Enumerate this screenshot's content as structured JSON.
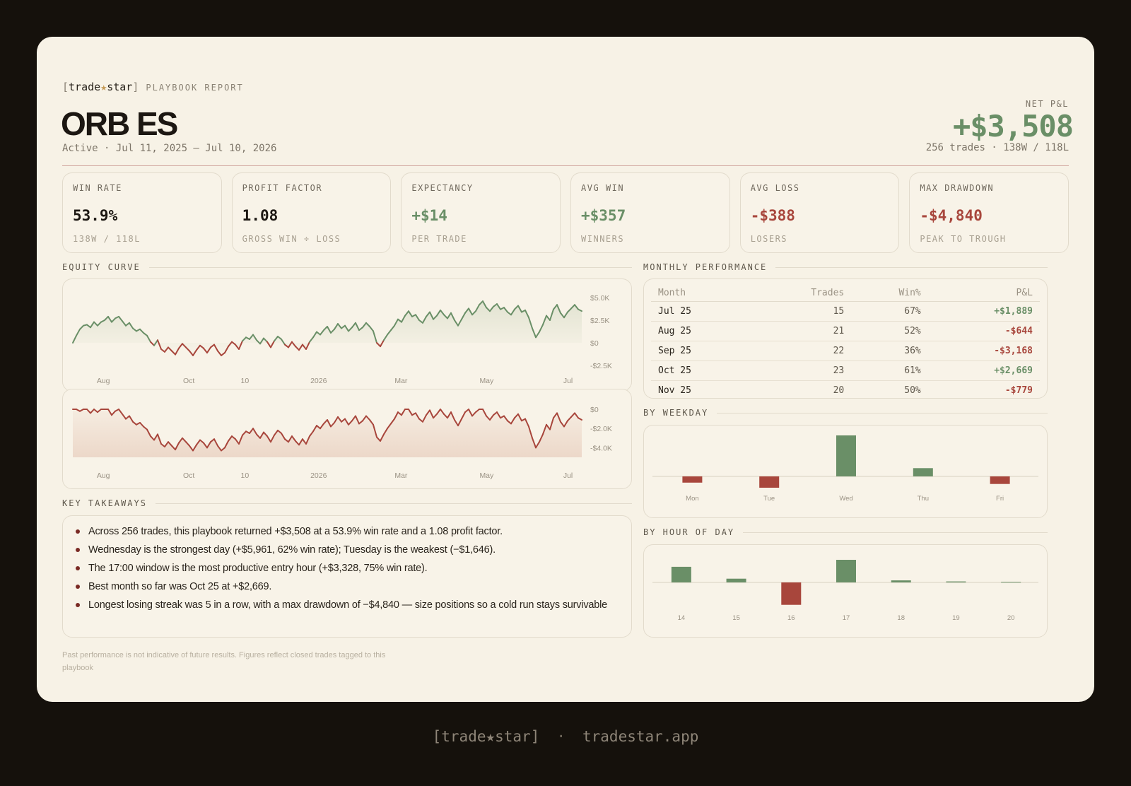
{
  "brand": {
    "open": "[",
    "name_a": "trade",
    "star": "★",
    "name_b": "star",
    "close": "]",
    "report_label": "PLAYBOOK REPORT"
  },
  "playbook": {
    "title": "ORB ES",
    "subtitle": "Active · Jul 11, 2025 – Jul 10, 2026"
  },
  "net": {
    "label": "NET P&L",
    "value": "+$3,508",
    "sub": "256 trades · 138W / 118L"
  },
  "stats": [
    {
      "label": "WIN RATE",
      "value": "53.9%",
      "sub": "138W / 118L",
      "tone": "neutral"
    },
    {
      "label": "PROFIT FACTOR",
      "value": "1.08",
      "sub": "GROSS WIN ÷ LOSS",
      "tone": "neutral"
    },
    {
      "label": "EXPECTANCY",
      "value": "+$14",
      "sub": "PER TRADE",
      "tone": "pos"
    },
    {
      "label": "AVG WIN",
      "value": "+$357",
      "sub": "WINNERS",
      "tone": "pos"
    },
    {
      "label": "AVG LOSS",
      "value": "-$388",
      "sub": "LOSERS",
      "tone": "neg"
    },
    {
      "label": "MAX DRAWDOWN",
      "value": "-$4,840",
      "sub": "PEAK TO TROUGH",
      "tone": "neg"
    }
  ],
  "sections": {
    "equity": "EQUITY CURVE",
    "monthly": "MONTHLY PERFORMANCE",
    "weekday": "BY WEEKDAY",
    "hour": "BY HOUR OF DAY",
    "takeaways": "KEY TAKEAWAYS"
  },
  "monthly": {
    "headers": [
      "Month",
      "Trades",
      "Win%",
      "P&L"
    ],
    "rows": [
      {
        "month": "Jul 25",
        "trades": "15",
        "win": "67%",
        "pnl": "+$1,889",
        "tone": "pos"
      },
      {
        "month": "Aug 25",
        "trades": "21",
        "win": "52%",
        "pnl": "-$644",
        "tone": "neg"
      },
      {
        "month": "Sep 25",
        "trades": "22",
        "win": "36%",
        "pnl": "-$3,168",
        "tone": "neg"
      },
      {
        "month": "Oct 25",
        "trades": "23",
        "win": "61%",
        "pnl": "+$2,669",
        "tone": "pos"
      },
      {
        "month": "Nov 25",
        "trades": "20",
        "win": "50%",
        "pnl": "-$779",
        "tone": "neg"
      }
    ]
  },
  "takeaways": [
    "Across 256 trades, this playbook returned +$3,508 at a 53.9% win rate and a 1.08 profit factor.",
    "Wednesday is the strongest day (+$5,961, 62% win rate); Tuesday is the weakest (−$1,646).",
    "The 17:00 window is the most productive entry hour (+$3,328, 75% win rate).",
    "Best month so far was Oct 25 at +$2,669.",
    "Longest losing streak was 5 in a row, with a max drawdown of −$4,840 — size positions so a cold run stays survivable"
  ],
  "disclaimer": "Past performance is not indicative of future results. Figures reflect closed trades tagged to this playbook",
  "footer": {
    "brand": "[trade★star]",
    "sep": "·",
    "url": "tradestar.app"
  },
  "colors": {
    "positive": "#6a8f67",
    "negative": "#a8463c",
    "card": "#f7f2e6",
    "frame": "#15110c"
  },
  "chart_data": [
    {
      "type": "line",
      "name": "equity",
      "x_tick_labels": [
        "Aug",
        "Oct",
        "10",
        "2026",
        "Mar",
        "May",
        "Jul"
      ],
      "y_tick_labels": [
        "$5.0K",
        "$2.5K",
        "$0",
        "-$2.5K"
      ],
      "ylim": [
        -2500,
        5000
      ],
      "values": [
        0,
        800,
        1500,
        1900,
        2000,
        1700,
        2300,
        1900,
        2300,
        2500,
        2900,
        2300,
        2700,
        2900,
        2400,
        1900,
        2200,
        1600,
        1300,
        1500,
        1100,
        800,
        100,
        -300,
        300,
        -700,
        -1000,
        -500,
        -900,
        -1300,
        -600,
        -100,
        -500,
        -900,
        -1400,
        -800,
        -300,
        -600,
        -1100,
        -500,
        -200,
        -900,
        -1400,
        -1100,
        -400,
        100,
        -200,
        -700,
        200,
        600,
        400,
        900,
        300,
        -100,
        500,
        100,
        -500,
        200,
        700,
        400,
        -200,
        -500,
        100,
        -400,
        -800,
        -200,
        -700,
        100,
        600,
        1200,
        900,
        1400,
        1800,
        1100,
        1500,
        2100,
        1600,
        1900,
        1300,
        1700,
        2200,
        1400,
        1700,
        2200,
        1800,
        1300,
        0,
        -400,
        300,
        900,
        1400,
        1900,
        2600,
        2300,
        3000,
        3500,
        2900,
        3100,
        2500,
        2200,
        2900,
        3400,
        2600,
        3000,
        3600,
        3100,
        2700,
        3300,
        2500,
        1900,
        2600,
        3300,
        3800,
        3100,
        3500,
        4200,
        4600,
        3900,
        3500,
        4000,
        4300,
        3700,
        3900,
        3400,
        3100,
        3700,
        4100,
        3400,
        3600,
        2800,
        1600,
        600,
        1200,
        2000,
        3000,
        2500,
        3700,
        4200,
        3300,
        2800,
        3400,
        3800,
        4200,
        3700,
        3508
      ]
    },
    {
      "type": "area",
      "name": "drawdown",
      "x_tick_labels": [
        "Aug",
        "Oct",
        "10",
        "2026",
        "Mar",
        "May",
        "Jul"
      ],
      "y_tick_labels": [
        "$0",
        "-$2.0K",
        "-$4.0K"
      ],
      "ylim": [
        -5000,
        0
      ],
      "values": [
        0,
        0,
        -200,
        0,
        0,
        -400,
        0,
        -300,
        0,
        0,
        0,
        -600,
        -200,
        0,
        -500,
        -1000,
        -700,
        -1300,
        -1600,
        -1400,
        -1800,
        -2100,
        -2800,
        -3200,
        -2600,
        -3600,
        -3900,
        -3400,
        -3800,
        -4200,
        -3500,
        -3000,
        -3400,
        -3800,
        -4300,
        -3700,
        -3200,
        -3500,
        -4000,
        -3400,
        -3100,
        -3800,
        -4300,
        -4000,
        -3300,
        -2800,
        -3100,
        -3600,
        -2700,
        -2300,
        -2500,
        -2000,
        -2600,
        -3000,
        -2400,
        -2800,
        -3400,
        -2700,
        -2200,
        -2500,
        -3100,
        -3400,
        -2800,
        -3300,
        -3700,
        -3100,
        -3600,
        -2800,
        -2300,
        -1700,
        -2000,
        -1500,
        -1100,
        -1800,
        -1400,
        -800,
        -1300,
        -1000,
        -1600,
        -1200,
        -700,
        -1500,
        -1200,
        -700,
        -1100,
        -1600,
        -2900,
        -3300,
        -2600,
        -2000,
        -1500,
        -1000,
        -300,
        -600,
        0,
        0,
        -600,
        -400,
        -1000,
        -1300,
        -600,
        -100,
        -900,
        -500,
        0,
        -500,
        -900,
        -300,
        -1100,
        -1700,
        -1000,
        -300,
        0,
        -700,
        -300,
        0,
        0,
        -700,
        -1100,
        -600,
        -300,
        -900,
        -700,
        -1200,
        -1500,
        -900,
        -500,
        -1200,
        -1000,
        -1800,
        -3000,
        -4000,
        -3400,
        -2600,
        -1600,
        -2100,
        -900,
        -400,
        -1300,
        -1800,
        -1200,
        -800,
        -400,
        -900,
        -1100
      ]
    },
    {
      "type": "bar",
      "name": "weekday",
      "categories": [
        "Mon",
        "Tue",
        "Wed",
        "Thu",
        "Fri"
      ],
      "values": [
        -900,
        -1646,
        5961,
        1200,
        -1100
      ]
    },
    {
      "type": "bar",
      "name": "hour",
      "categories": [
        "14",
        "15",
        "16",
        "17",
        "18",
        "19",
        "20"
      ],
      "values": [
        2300,
        550,
        -3300,
        3328,
        300,
        150,
        80
      ]
    }
  ]
}
